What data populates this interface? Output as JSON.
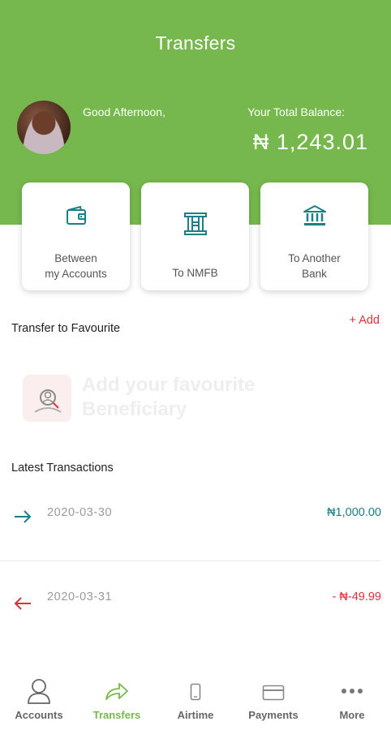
{
  "header": {
    "title": "Transfers",
    "greeting": "Good Afternoon,",
    "balance_label": "Your Total Balance:",
    "balance_value": "₦ 1,243.01",
    "color": "#76b84d"
  },
  "transfer_options": [
    {
      "line1": "Between",
      "line2": "my Accounts",
      "icon": "wallet-icon"
    },
    {
      "line1": "To NMFB",
      "line2": "",
      "icon": "bank-logo-icon"
    },
    {
      "line1": "To Another",
      "line2": "Bank",
      "icon": "bank-building-icon"
    }
  ],
  "favourites": {
    "title": "Transfer to Favourite",
    "add_label": "+ Add",
    "empty_line1": "Add your favourite",
    "empty_line2": "Beneficiary",
    "empty_icon": "add-beneficiary-icon"
  },
  "transactions": {
    "title": "Latest Transactions",
    "items": [
      {
        "date": "2020-03-30",
        "amount": "₦1,000.00",
        "direction": "incoming",
        "color": "#1a7f86",
        "icon": "arrow-right-icon"
      },
      {
        "date": "2020-03-31",
        "amount": "- ₦-49.99",
        "direction": "outgoing",
        "color": "#e0303a",
        "icon": "arrow-left-icon"
      }
    ]
  },
  "tabs": [
    {
      "label": "Accounts",
      "icon": "user-icon",
      "active": false
    },
    {
      "label": "Transfers",
      "icon": "share-arrow-icon",
      "active": true
    },
    {
      "label": "Airtime",
      "icon": "phone-icon",
      "active": false
    },
    {
      "label": "Payments",
      "icon": "card-icon",
      "active": false
    },
    {
      "label": "More",
      "icon": "more-dots-icon",
      "active": false
    }
  ],
  "colors": {
    "accent_green": "#76b84d",
    "teal": "#1a7f86",
    "red": "#e0303a"
  }
}
